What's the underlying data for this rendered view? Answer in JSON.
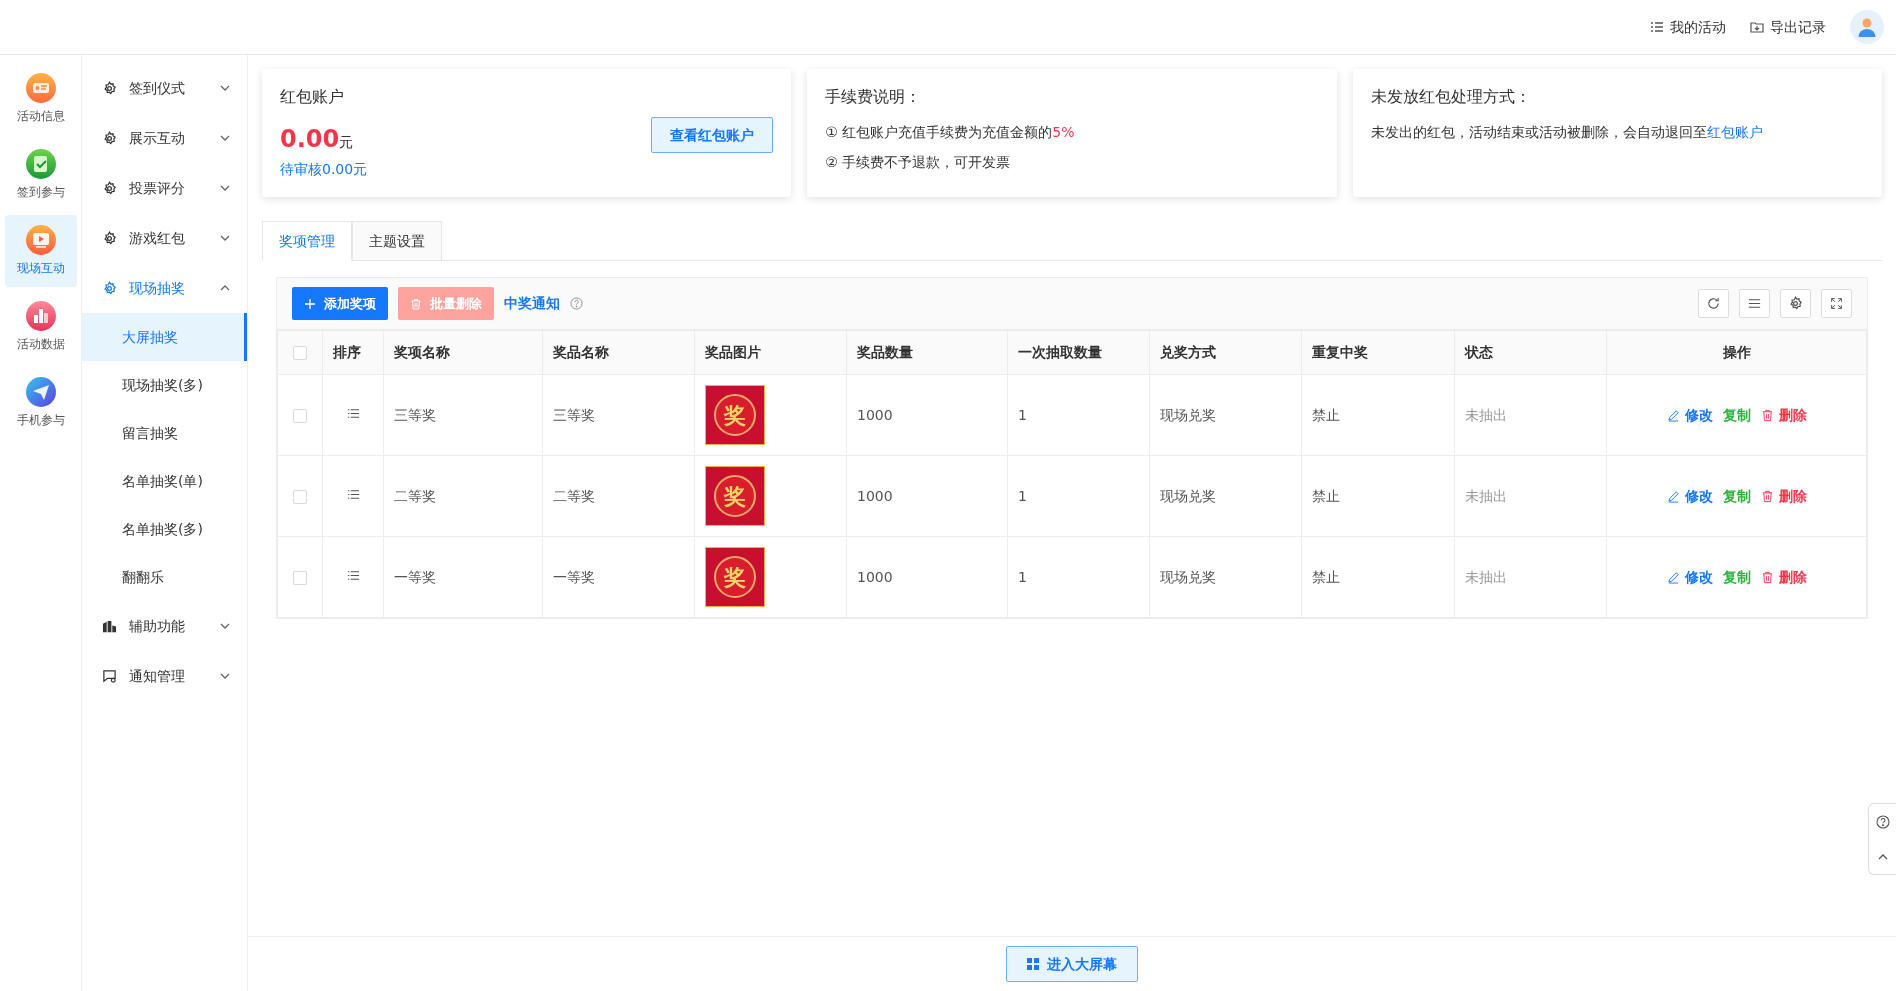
{
  "header": {
    "actions": [
      "我的活动",
      "导出记录"
    ]
  },
  "rail": [
    {
      "label": "活动信息",
      "selected": false
    },
    {
      "label": "签到参与",
      "selected": false
    },
    {
      "label": "现场互动",
      "selected": true
    },
    {
      "label": "活动数据",
      "selected": false
    },
    {
      "label": "手机参与",
      "selected": false
    }
  ],
  "menu": [
    {
      "label": "签到仪式",
      "expanded": false
    },
    {
      "label": "展示互动",
      "expanded": false
    },
    {
      "label": "投票评分",
      "expanded": false
    },
    {
      "label": "游戏红包",
      "expanded": false
    },
    {
      "label": "现场抽奖",
      "expanded": true,
      "children": [
        {
          "label": "大屏抽奖",
          "selected": true
        },
        {
          "label": "现场抽奖(多)",
          "selected": false
        },
        {
          "label": "留言抽奖",
          "selected": false
        },
        {
          "label": "名单抽奖(单)",
          "selected": false
        },
        {
          "label": "名单抽奖(多)",
          "selected": false
        },
        {
          "label": "翻翻乐",
          "selected": false
        }
      ]
    },
    {
      "label": "辅助功能",
      "expanded": false
    },
    {
      "label": "通知管理",
      "expanded": false
    }
  ],
  "account_card": {
    "title": "红包账户",
    "amount": "0.00",
    "unit": "元",
    "pending": "待审核0.00元",
    "button": "查看红包账户"
  },
  "fee_card": {
    "title": "手续费说明：",
    "lines": [
      {
        "text": "① 红包账户充值手续费为充值金额的",
        "highlight": "5%"
      },
      {
        "text": "② 手续费不予退款，可开发票"
      }
    ]
  },
  "unsent_card": {
    "title": "未发放红包处理方式：",
    "text": "未发出的红包，活动结束或活动被删除，会自动退回至",
    "link": "红包账户"
  },
  "tabs": [
    {
      "label": "奖项管理",
      "selected": true
    },
    {
      "label": "主题设置",
      "selected": false
    }
  ],
  "toolbar": {
    "add": "添加奖项",
    "batch_delete": "批量删除",
    "batch_delete_disabled": true,
    "notice": "中奖通知"
  },
  "table": {
    "all_checked": false,
    "columns": [
      "排序",
      "奖项名称",
      "奖品名称",
      "奖品图片",
      "奖品数量",
      "一次抽取数量",
      "兑奖方式",
      "重复中奖",
      "状态",
      "操作"
    ],
    "rows": [
      {
        "checked": false,
        "name": "三等奖",
        "prize": "三等奖",
        "image": "奖",
        "quantity": "1000",
        "per_draw": "1",
        "redeem": "现场兑奖",
        "repeat": "禁止",
        "status": "未抽出",
        "actions": [
          "修改",
          "复制",
          "删除"
        ]
      },
      {
        "checked": false,
        "name": "二等奖",
        "prize": "二等奖",
        "image": "奖",
        "quantity": "1000",
        "per_draw": "1",
        "redeem": "现场兑奖",
        "repeat": "禁止",
        "status": "未抽出",
        "actions": [
          "修改",
          "复制",
          "删除"
        ]
      },
      {
        "checked": false,
        "name": "一等奖",
        "prize": "一等奖",
        "image": "奖",
        "quantity": "1000",
        "per_draw": "1",
        "redeem": "现场兑奖",
        "repeat": "禁止",
        "status": "未抽出",
        "actions": [
          "修改",
          "复制",
          "删除"
        ]
      }
    ]
  },
  "footer": {
    "button": "进入大屏幕"
  }
}
